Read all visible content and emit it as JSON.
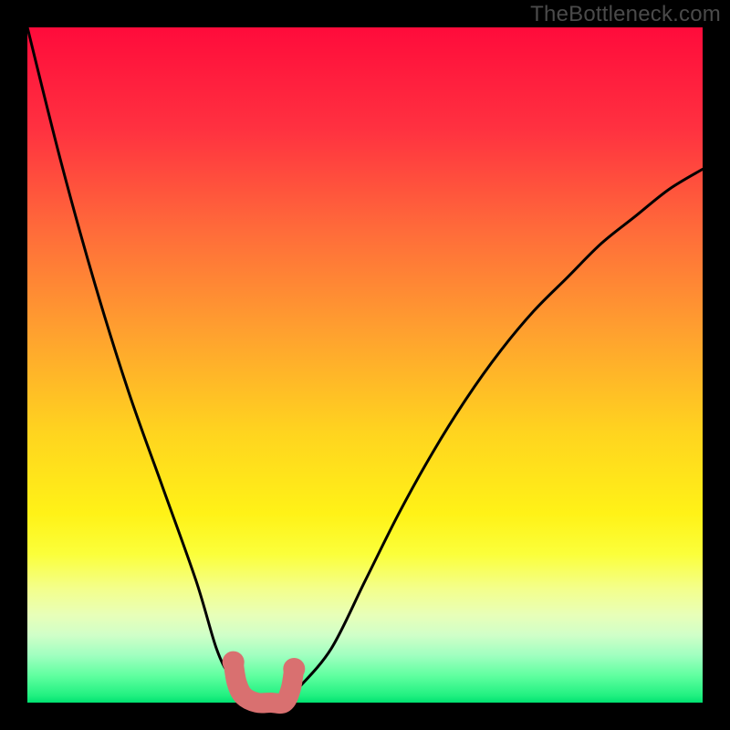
{
  "watermark": "TheBottleneck.com",
  "chart_data": {
    "type": "line",
    "title": "",
    "xlabel": "",
    "ylabel": "",
    "xlim": [
      0,
      100
    ],
    "ylim": [
      0,
      100
    ],
    "x": [
      0,
      5,
      10,
      15,
      20,
      25,
      28,
      30,
      32,
      34,
      36,
      38,
      40,
      45,
      50,
      55,
      60,
      65,
      70,
      75,
      80,
      85,
      90,
      95,
      100
    ],
    "y": [
      100,
      80,
      62,
      46,
      32,
      18,
      8,
      4,
      2,
      0,
      0,
      0,
      2,
      8,
      18,
      28,
      37,
      45,
      52,
      58,
      63,
      68,
      72,
      76,
      79
    ],
    "series_color": "#000000",
    "background_gradient": {
      "type": "vertical",
      "stops": [
        {
          "pos": 0.0,
          "color": "#ff0b3b"
        },
        {
          "pos": 0.15,
          "color": "#ff3140"
        },
        {
          "pos": 0.3,
          "color": "#ff6b3a"
        },
        {
          "pos": 0.45,
          "color": "#ffa02f"
        },
        {
          "pos": 0.6,
          "color": "#ffd41f"
        },
        {
          "pos": 0.72,
          "color": "#fff217"
        },
        {
          "pos": 0.78,
          "color": "#fbff3a"
        },
        {
          "pos": 0.83,
          "color": "#f4ff8a"
        },
        {
          "pos": 0.87,
          "color": "#e8ffb8"
        },
        {
          "pos": 0.9,
          "color": "#d0ffc8"
        },
        {
          "pos": 0.93,
          "color": "#a0ffc0"
        },
        {
          "pos": 0.96,
          "color": "#60ffa0"
        },
        {
          "pos": 0.99,
          "color": "#20f080"
        },
        {
          "pos": 1.0,
          "color": "#00e070"
        }
      ]
    },
    "marker_overlay": {
      "color": "#d97070",
      "points": [
        {
          "x": 30.5,
          "y": 6
        },
        {
          "x": 31,
          "y": 3
        },
        {
          "x": 32,
          "y": 1
        },
        {
          "x": 34,
          "y": 0
        },
        {
          "x": 36,
          "y": 0
        },
        {
          "x": 38,
          "y": 0
        },
        {
          "x": 39,
          "y": 2
        },
        {
          "x": 39.5,
          "y": 5
        }
      ]
    }
  }
}
